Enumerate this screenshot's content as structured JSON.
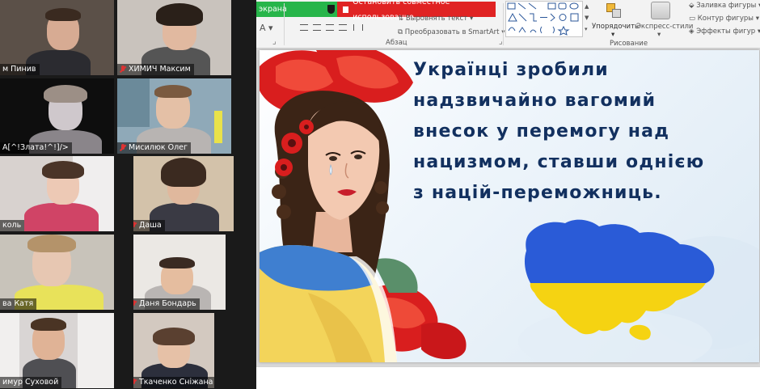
{
  "gallery": {
    "participants": [
      {
        "name": "м Пинив",
        "muted": false
      },
      {
        "name": "ХИМИЧ Максим",
        "muted": true
      },
      {
        "name": "А[^!Злата!^!]/>",
        "muted": false
      },
      {
        "name": "Мисилюк Олег",
        "muted": true
      },
      {
        "name": "коль",
        "muted": false
      },
      {
        "name": "Даша",
        "muted": true
      },
      {
        "name": "ва Катя",
        "muted": false
      },
      {
        "name": "Даня Бондарь",
        "muted": true
      },
      {
        "name": "имур Суховой",
        "muted": false
      },
      {
        "name": "Ткаченко Сніжана",
        "muted": true
      }
    ]
  },
  "share_bar": {
    "left_label": "экрана",
    "stop_label": "Остановить совместное использование"
  },
  "ribbon": {
    "text_direction": "Выровнять текст",
    "smartart": "Преобразовать в SmartArt",
    "paragraph_group": "Абзац",
    "arrange": "Упорядочить",
    "quick_styles": "Экспресс-стили",
    "drawing_group": "Рисование",
    "shape_fill": "Заливка фигуры",
    "shape_outline": "Контур фигуры",
    "shape_effects": "Эффекты фигур",
    "font_size_icon": "A"
  },
  "slide": {
    "lines": [
      "Українці зробили",
      "надзвичайно вагомий",
      "внесок у перемогу над",
      "нацизмом, ставши однією",
      "з націй-переможниць."
    ]
  },
  "colors": {
    "share_green": "#27b54a",
    "share_red": "#e02323",
    "slide_text": "#12305f",
    "ukraine_blue": "#2a5bd7",
    "ukraine_yellow": "#f5d312",
    "poppy_red": "#d91e1e"
  }
}
